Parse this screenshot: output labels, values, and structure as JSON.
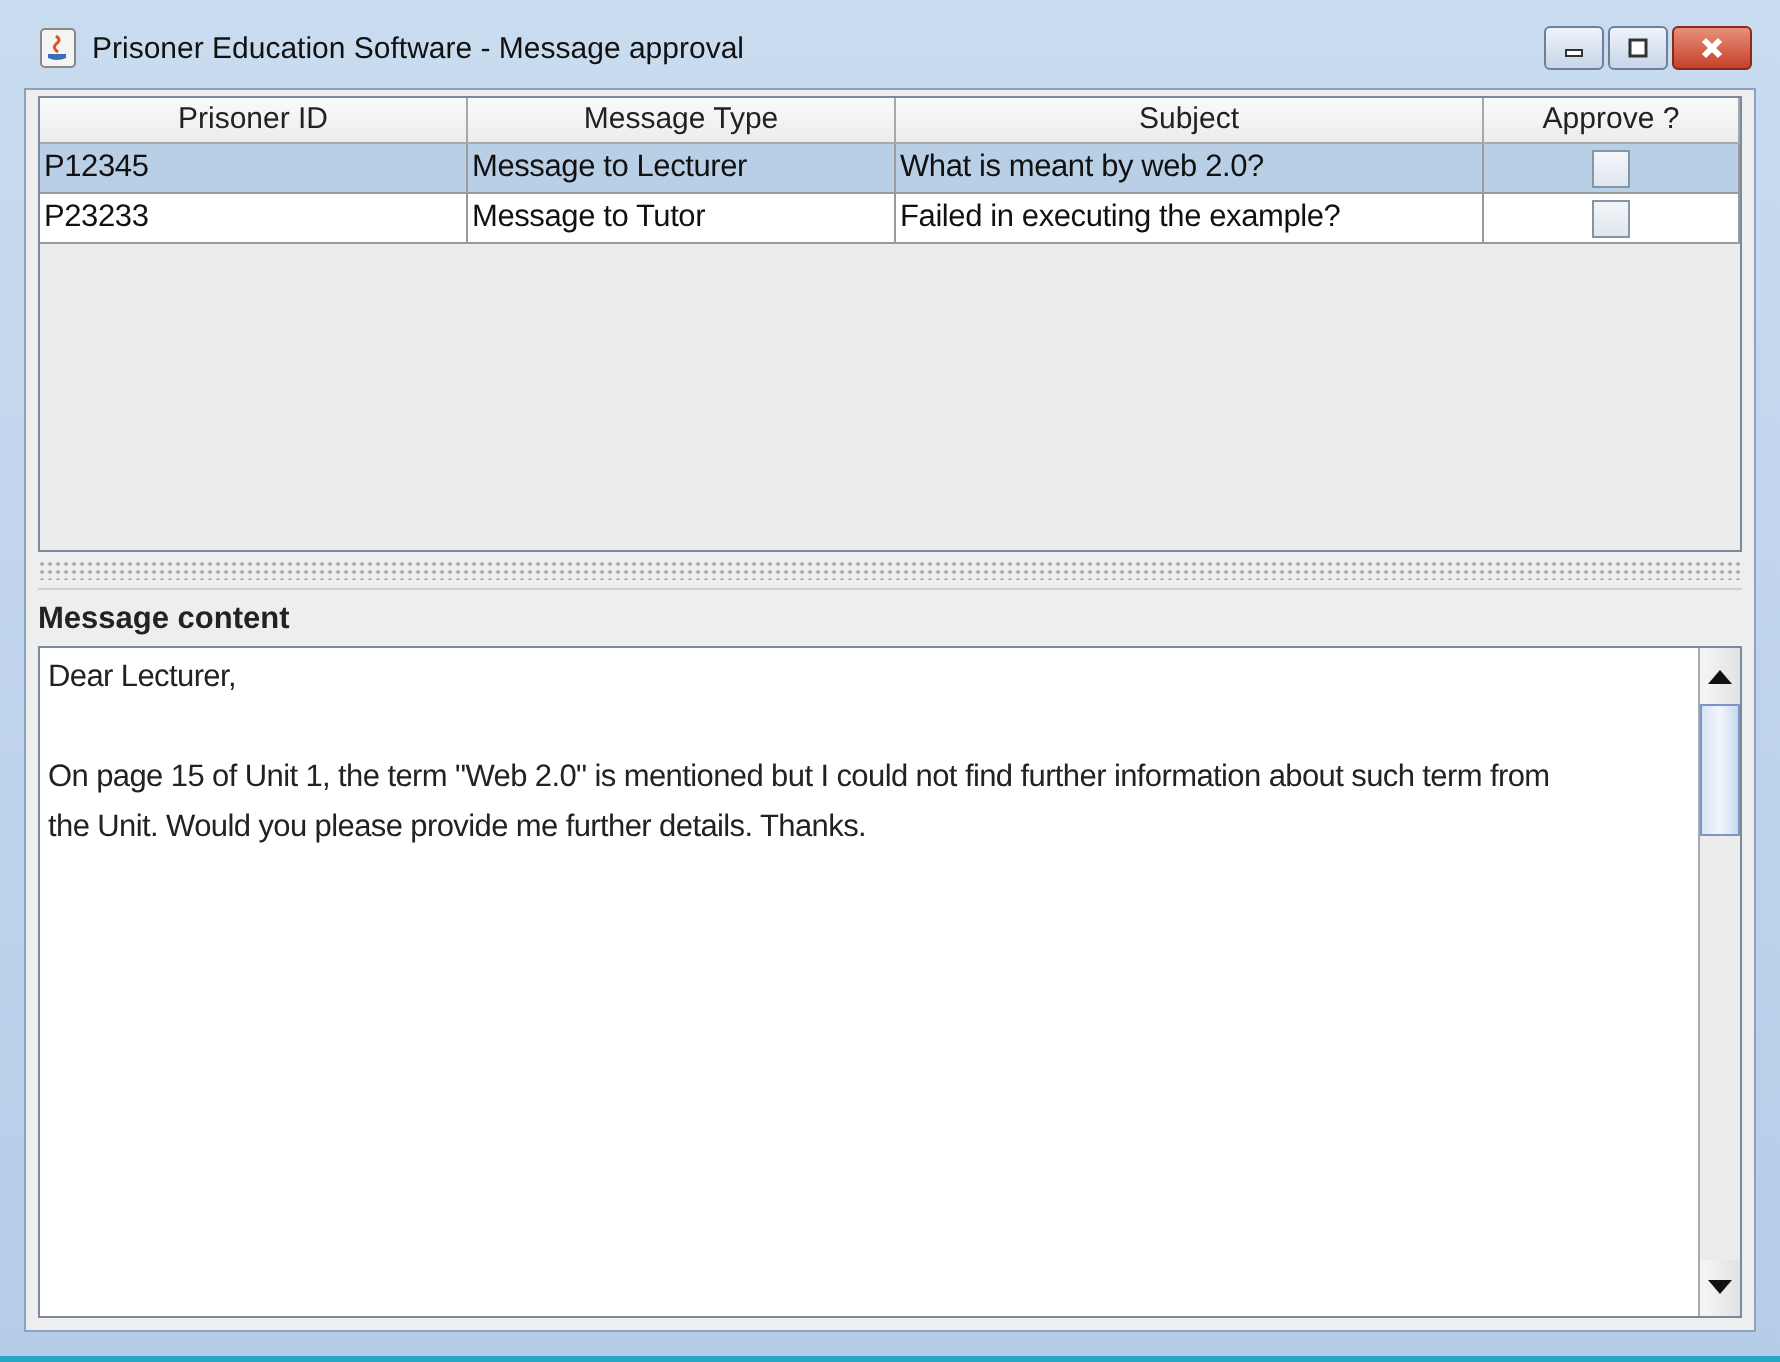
{
  "window": {
    "title": "Prisoner Education Software - Message approval"
  },
  "table": {
    "columns": [
      "Prisoner ID",
      "Message Type",
      "Subject",
      "Approve ?"
    ],
    "rows": [
      {
        "prisoner_id": "P12345",
        "message_type": "Message to Lecturer",
        "subject": "What is meant by web 2.0?",
        "approved": false,
        "selected": true
      },
      {
        "prisoner_id": "P23233",
        "message_type": "Message to Tutor",
        "subject": "Failed in executing the example?",
        "approved": false,
        "selected": false
      }
    ]
  },
  "message": {
    "label": "Message content",
    "paragraphs": [
      "Dear Lecturer,",
      "On page 15 of Unit 1, the term \"Web 2.0\" is mentioned but I could not find further information about such term from the Unit. Would you please provide me further details. Thanks."
    ]
  }
}
